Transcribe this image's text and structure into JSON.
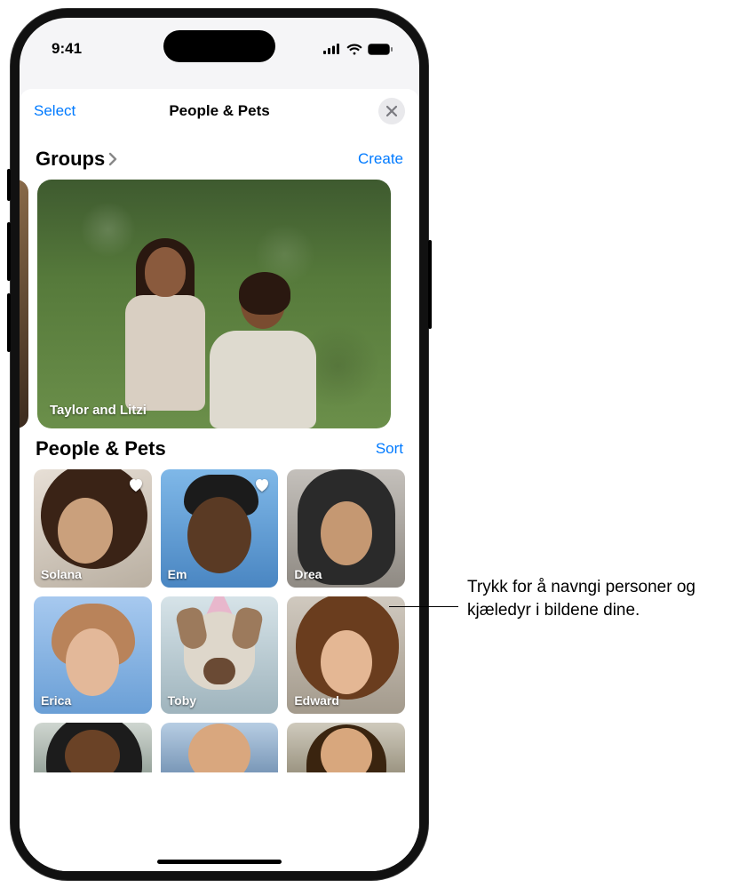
{
  "status": {
    "time": "9:41"
  },
  "nav": {
    "left": "Select",
    "title": "People & Pets"
  },
  "sections": {
    "groups": {
      "title": "Groups",
      "action": "Create"
    },
    "people": {
      "title": "People & Pets",
      "action": "Sort"
    }
  },
  "group_card": {
    "label": "Taylor and Litzi"
  },
  "people_tiles": [
    {
      "name": "Solana",
      "favorite": true
    },
    {
      "name": "Em",
      "favorite": true
    },
    {
      "name": "Drea",
      "favorite": false
    },
    {
      "name": "Erica",
      "favorite": false
    },
    {
      "name": "Toby",
      "favorite": false
    },
    {
      "name": "Edward",
      "favorite": false
    }
  ],
  "callout": "Trykk for å navngi personer og kjæledyr i bildene dine."
}
